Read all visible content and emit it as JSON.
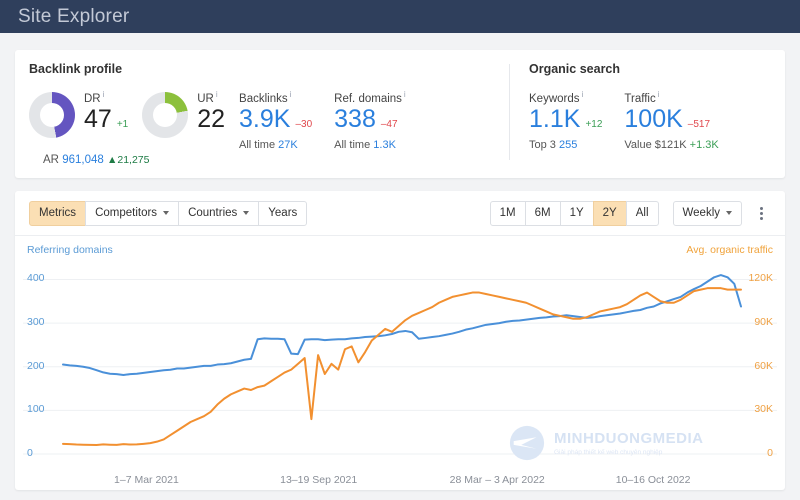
{
  "header": {
    "title": "Site Explorer"
  },
  "backlink": {
    "section_title": "Backlink profile",
    "dr": {
      "label": "DR",
      "value": "47",
      "delta": "+1",
      "percent": 47,
      "color": "#6455c0"
    },
    "ur": {
      "label": "UR",
      "value": "22",
      "percent": 22,
      "color": "#8cc03c"
    },
    "backlinks": {
      "label": "Backlinks",
      "value": "3.9K",
      "delta": "–30",
      "sub_label": "All time",
      "sub_value": "27K"
    },
    "ref_domains": {
      "label": "Ref. domains",
      "value": "338",
      "delta": "–47",
      "sub_label": "All time",
      "sub_value": "1.3K"
    },
    "ar": {
      "label": "AR",
      "value": "961,048",
      "delta": "▲21,275"
    }
  },
  "organic": {
    "section_title": "Organic search",
    "keywords": {
      "label": "Keywords",
      "value": "1.1K",
      "delta": "+12",
      "sub_label": "Top 3",
      "sub_value": "255"
    },
    "traffic": {
      "label": "Traffic",
      "value": "100K",
      "delta": "–517",
      "sub_label": "Value",
      "sub_value": "$121K",
      "sub_delta": "+1.3K"
    }
  },
  "toolbar": {
    "tabs": [
      {
        "label": "Metrics",
        "active": true,
        "caret": false
      },
      {
        "label": "Competitors",
        "active": false,
        "caret": true
      },
      {
        "label": "Countries",
        "active": false,
        "caret": true
      },
      {
        "label": "Years",
        "active": false,
        "caret": false
      }
    ],
    "ranges": [
      {
        "label": "1M",
        "active": false
      },
      {
        "label": "6M",
        "active": false
      },
      {
        "label": "1Y",
        "active": false
      },
      {
        "label": "2Y",
        "active": true
      },
      {
        "label": "All",
        "active": false
      }
    ],
    "granularity": "Weekly",
    "menu_icon": "kebab-menu-icon"
  },
  "watermark": {
    "name": "MINHDUONGMEDIA",
    "tagline": "Giải pháp thiết kế web chuyên nghiệp",
    "logo_icon": "globe-arrow-icon"
  },
  "chart_data": {
    "type": "line",
    "title": "",
    "grid": true,
    "legend_position": "top",
    "series": [
      {
        "name": "Referring domains",
        "axis": "left",
        "color": "#4a90d9",
        "values": [
          205,
          203,
          202,
          200,
          197,
          192,
          187,
          184,
          183,
          181,
          183,
          184,
          186,
          188,
          190,
          192,
          193,
          196,
          196,
          198,
          200,
          202,
          202,
          205,
          206,
          208,
          212,
          216,
          218,
          263,
          265,
          264,
          264,
          263,
          230,
          229,
          262,
          263,
          263,
          261,
          262,
          263,
          263,
          265,
          266,
          268,
          269,
          270,
          272,
          275,
          280,
          282,
          279,
          264,
          266,
          268,
          270,
          273,
          276,
          280,
          285,
          288,
          292,
          296,
          298,
          300,
          303,
          305,
          306,
          308,
          310,
          312,
          313,
          315,
          316,
          318,
          316,
          314,
          312,
          313,
          316,
          318,
          320,
          322,
          325,
          328,
          330,
          335,
          338,
          345,
          350,
          355,
          360,
          370,
          378,
          385,
          395,
          405,
          410,
          405,
          390,
          338
        ]
      },
      {
        "name": "Avg. organic traffic",
        "axis": "right",
        "color": "#f29030",
        "values": [
          7000,
          6800,
          6500,
          6400,
          6300,
          6200,
          6600,
          6400,
          6300,
          6800,
          6500,
          6600,
          7000,
          7500,
          8500,
          10000,
          13000,
          16000,
          19000,
          22000,
          24000,
          26000,
          29000,
          34000,
          38000,
          41000,
          43000,
          45000,
          44000,
          46000,
          47000,
          50000,
          53000,
          56000,
          58000,
          62000,
          66000,
          24000,
          68000,
          55000,
          62000,
          58000,
          72000,
          74000,
          63000,
          70000,
          78000,
          82000,
          86000,
          84000,
          88000,
          92000,
          95000,
          97000,
          99000,
          101000,
          104000,
          106000,
          108000,
          109000,
          110000,
          111000,
          111000,
          110000,
          109000,
          108000,
          107000,
          106000,
          105000,
          104000,
          102000,
          100000,
          98000,
          96000,
          95000,
          94000,
          93000,
          93000,
          94000,
          96000,
          98000,
          99000,
          100000,
          101000,
          103000,
          106000,
          109000,
          111000,
          108000,
          105000,
          104000,
          104000,
          106000,
          109000,
          112000,
          113000,
          114000,
          114000,
          114000,
          113000,
          113000,
          113000
        ]
      }
    ],
    "y_left": {
      "ticks": [
        "400",
        "300",
        "200",
        "100",
        "0"
      ],
      "values": [
        400,
        300,
        200,
        100,
        0
      ],
      "min": 0,
      "max": 440,
      "label": "Referring domains",
      "color": "#5b9bd5"
    },
    "y_right": {
      "ticks": [
        "120K",
        "90K",
        "60K",
        "30K",
        "0"
      ],
      "values": [
        120000,
        90000,
        60000,
        30000,
        0
      ],
      "min": 0,
      "max": 132000,
      "label": "Avg. organic traffic",
      "color": "#efa144"
    },
    "x_ticks": [
      {
        "label": "1–7 Mar 2021",
        "pos": 0.09
      },
      {
        "label": "13–19 Sep 2021",
        "pos": 0.335
      },
      {
        "label": "28 Mar – 3 Apr 2022",
        "pos": 0.585
      },
      {
        "label": "10–16 Oct 2022",
        "pos": 0.83
      }
    ]
  }
}
